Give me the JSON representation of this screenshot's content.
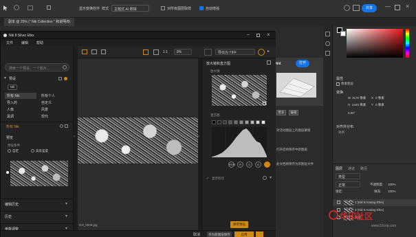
{
  "ps": {
    "options": {
      "align_label": "显示变换控件",
      "style_label": "样式",
      "style_value": "主题式 AI 照相",
      "snap_label": "对所有图层取样",
      "auto_label": "自动增强",
      "share_button": "共享"
    },
    "tab_title": "副本 @ 25% (\" Nik Collection \" 和说明/8)",
    "discover": {
      "title": "fex",
      "open_button": "打开",
      "row1": "更多",
      "row2": "编辑",
      "line1": "对活动图层上的图层蒙版",
      "line2": "打开后将保存中新图层",
      "line3": "此文档将保存为新图层文件"
    },
    "right": {
      "tab_properties": "属性",
      "section_transform": "变换",
      "w_label": "W",
      "w_value": "3170 像素",
      "x_label": "X",
      "x_value": "0 像素",
      "h_label": "H",
      "h_value": "2440 像素",
      "y_label": "Y",
      "y_value": "0 像素",
      "angle_value": "0.00°",
      "section_align": "对齐并分布",
      "align_sub": "对齐:",
      "layers_tab": "图层",
      "channels_tab": "通道",
      "paths_tab": "路径",
      "kind_value": "类型",
      "blend_value": "正常",
      "opacity_label": "不透明度:",
      "opacity_value": "100%",
      "lock_label": "锁定:",
      "fill_label": "填充:",
      "fill_value": "100%",
      "layer1": "1 (Nik 8 Analog Efex)",
      "layer2": "2 (Nik 8 Analog Efex)",
      "layer3": "背景"
    }
  },
  "nik": {
    "title": "Nik 8 Silver Efex",
    "menu": [
      "文件",
      "编辑",
      "帮助"
    ],
    "search_placeholder": "搜索一个预设、一个胶片...",
    "section_presets": "预设",
    "filter_nik": "Nik",
    "filters": [
      {
        "label": "所有 Nik",
        "active": true
      },
      {
        "label": "所有个人",
        "active": false
      },
      {
        "label": "导入的",
        "active": false
      },
      {
        "label": "自定义",
        "active": false
      },
      {
        "label": "人像",
        "active": false
      },
      {
        "label": "风景",
        "active": false
      },
      {
        "label": "黑调",
        "active": false
      },
      {
        "label": "现代",
        "active": false
      }
    ],
    "all_nik_label": "所有 Nik",
    "preview_label": "预览",
    "preview_sub": "预设条件",
    "preview_opt1": "自定",
    "preview_opt2": "高反差度",
    "section_edit_history": "编辑历史",
    "section_history": "历史",
    "section_params": "参数调整",
    "toolbar": {
      "zoom_value": "8%",
      "ratio_label": "1:1",
      "export_value": "导出为 TIFF"
    },
    "file_name": "DJI_0848.jpg",
    "right_panel": {
      "title": "放大镜和直方图",
      "sub": "放大镜",
      "histogram_label": "直方图",
      "channel_buttons": [
        "RGB",
        "R",
        "G",
        "B"
      ],
      "pre_hist_label": "显示剪切"
    },
    "save_preset_button": "保存预设",
    "bottom": {
      "cancel_button": "取消",
      "save_as_button": "作为新图层保存",
      "apply_button": "应用"
    }
  },
  "watermark": {
    "text": "华印社区",
    "url": "www.52cnp.com"
  },
  "colors": {
    "accent_blue": "#1473e6",
    "accent_orange": "#d18a11",
    "panel_bg": "#232323"
  },
  "chart_data": {
    "type": "area",
    "title": "",
    "xlabel": "",
    "ylabel": "",
    "x": [
      0,
      16,
      32,
      48,
      64,
      80,
      96,
      112,
      128,
      144,
      160,
      176,
      192,
      208,
      224,
      240,
      255
    ],
    "values": [
      0.02,
      0.05,
      0.1,
      0.16,
      0.26,
      0.38,
      0.52,
      0.68,
      0.82,
      0.95,
      1.0,
      0.88,
      0.7,
      0.55,
      0.5,
      0.3,
      0.05
    ],
    "xlim": [
      0,
      255
    ],
    "ylim": [
      0,
      1
    ]
  }
}
